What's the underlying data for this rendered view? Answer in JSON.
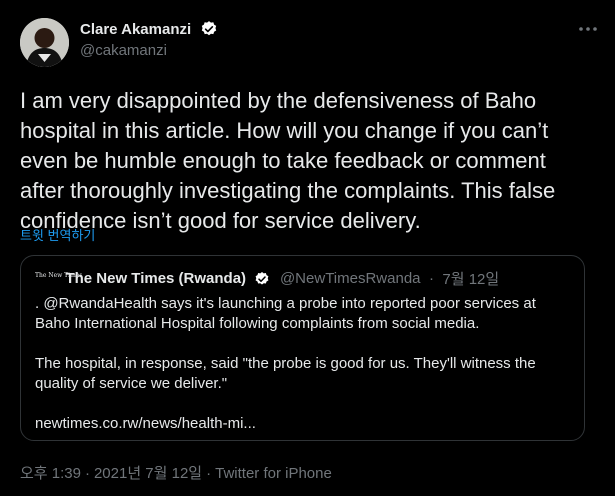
{
  "author": {
    "display_name": "Clare Akamanzi",
    "handle": "@cakamanzi",
    "verified_icon": "verified-badge-icon"
  },
  "tweet": {
    "text": "I am very disappointed by the defensiveness of Baho hospital in this article. How will you change if you can’t even be humble enough to take feedback or comment after thoroughly investigating the complaints. This false confidence isn’t good for service delivery.",
    "translate_label": "트윗 번역하기"
  },
  "quote": {
    "logo_text": "The New Times",
    "name": "The New Times (Rwanda)",
    "handle": "@NewTimesRwanda",
    "separator": "·",
    "date": "7월 12일",
    "paragraph_1": ". @RwandaHealth says it's launching a probe into reported poor services at Baho International Hospital following complaints from social media.",
    "paragraph_2": "The hospital, in response, said \"the probe is good for us. They'll witness the quality of service we deliver.\"",
    "link": "newtimes.co.rw/news/health-mi..."
  },
  "meta": {
    "time": "오후 1:39",
    "separator": "·",
    "date": "2021년 7월 12일",
    "source": "Twitter for iPhone"
  },
  "colors": {
    "background": "#000000",
    "text": "#e7e9ea",
    "muted": "#71767b",
    "link": "#1d9bf0",
    "verified": "#ffffff",
    "border": "#2f3336"
  }
}
